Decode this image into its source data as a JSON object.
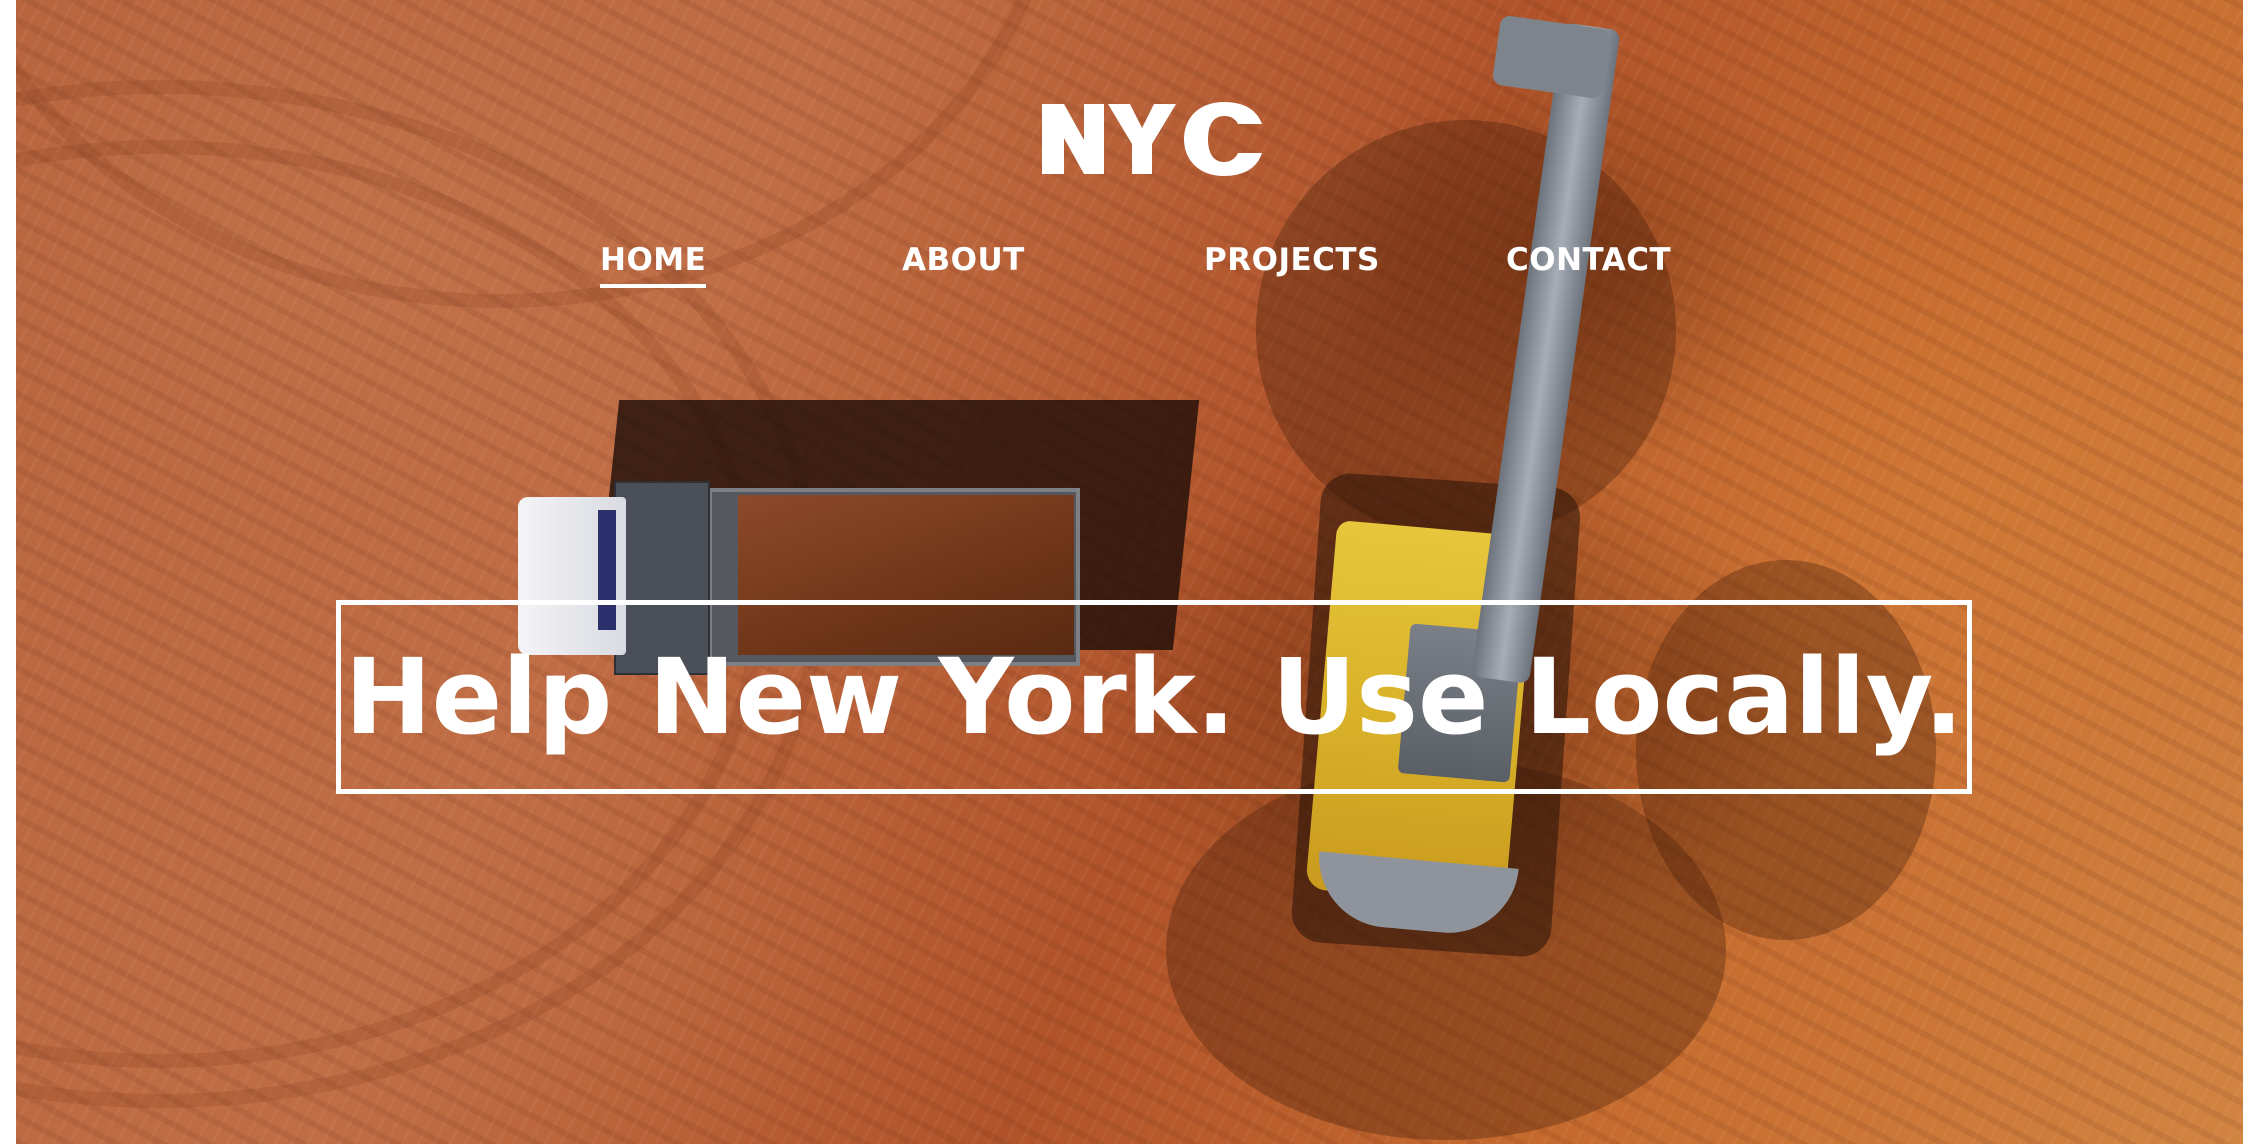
{
  "brand": {
    "logo_text": "NYC",
    "logo_icon": "nyc-logo-icon",
    "logo_color": "#ffffff"
  },
  "nav": {
    "items": [
      {
        "label": "HOME",
        "active": true
      },
      {
        "label": "ABOUT",
        "active": false
      },
      {
        "label": "PROJECTS",
        "active": false
      },
      {
        "label": "CONTACT",
        "active": false
      }
    ]
  },
  "hero": {
    "headline": "Help New York. Use Locally.",
    "background_image": "aerial-construction-site-image",
    "accent_color": "#ffffff",
    "soil_color": "#b8653f"
  }
}
